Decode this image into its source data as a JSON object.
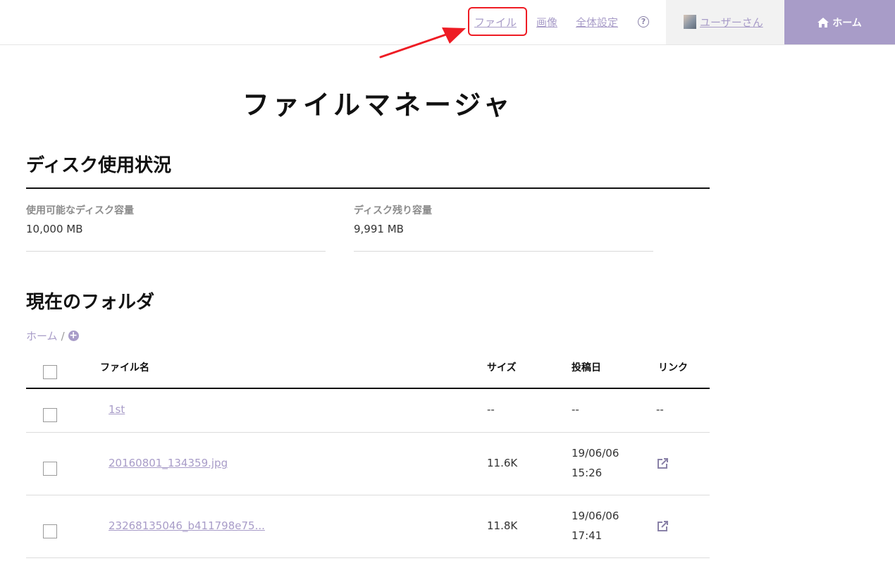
{
  "header": {
    "nav": {
      "files": "ファイル",
      "images": "画像",
      "settings": "全体設定",
      "help_icon": "?"
    },
    "user": {
      "name": "ユーザーさん"
    },
    "home_button": "ホーム",
    "accent_color": "#a89cc8",
    "annotation_color": "#ee1c24"
  },
  "page": {
    "title": "ファイルマネージャ"
  },
  "disk": {
    "title": "ディスク使用状況",
    "available_label": "使用可能なディスク容量",
    "available_value": "10,000 MB",
    "remaining_label": "ディスク残り容量",
    "remaining_value": "9,991 MB"
  },
  "folder": {
    "title": "現在のフォルダ",
    "breadcrumb_home": "ホーム",
    "breadcrumb_sep": "/",
    "add_icon": "+"
  },
  "table": {
    "columns": {
      "name": "ファイル名",
      "size": "サイズ",
      "date": "投稿日",
      "link": "リンク"
    },
    "rows": [
      {
        "name": "1st",
        "size": "--",
        "date": "--",
        "time": "",
        "link": "--"
      },
      {
        "name": "20160801_134359.jpg",
        "size": "11.6K",
        "date": "19/06/06",
        "time": "15:26",
        "link": "external-link-icon"
      },
      {
        "name": "23268135046_b411798e75...",
        "size": "11.8K",
        "date": "19/06/06",
        "time": "17:41",
        "link": "external-link-icon"
      }
    ]
  }
}
